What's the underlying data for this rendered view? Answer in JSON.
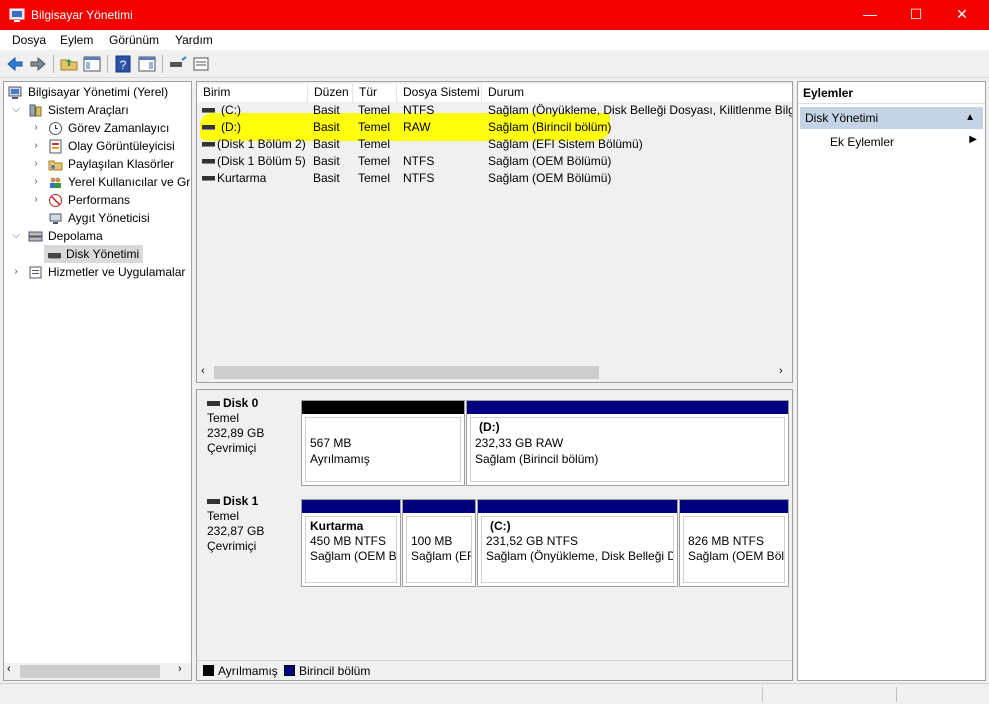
{
  "window": {
    "title": "Bilgisayar Yönetimi",
    "minimize": "—",
    "maximize": "☐",
    "close": "✕",
    "accent": "#f40000"
  },
  "menu": [
    "Dosya",
    "Eylem",
    "Görünüm",
    "Yardım"
  ],
  "tree": {
    "root": "Bilgisayar Yönetimi (Yerel)",
    "system_tools": "Sistem Araçları",
    "task_scheduler": "Görev Zamanlayıcı",
    "event_viewer": "Olay Görüntüleyicisi",
    "shared_folders": "Paylaşılan Klasörler",
    "local_users": "Yerel Kullanıcılar ve Gru",
    "performance": "Performans",
    "device_manager": "Aygıt Yöneticisi",
    "storage": "Depolama",
    "disk_management": "Disk Yönetimi",
    "services": "Hizmetler ve Uygulamalar"
  },
  "volumes": {
    "headers": [
      "Birim",
      "Düzen",
      "Tür",
      "Dosya Sistemi",
      "Durum"
    ],
    "rows": [
      [
        "(C:)",
        "Basit",
        "Temel",
        "NTFS",
        "Sağlam (Önyükleme, Disk Belleği Dosyası, Kilitlenme Bilgis"
      ],
      [
        "(D:)",
        "Basit",
        "Temel",
        "RAW",
        "Sağlam (Birincil bölüm)"
      ],
      [
        "(Disk 1 Bölüm 2)",
        "Basit",
        "Temel",
        "",
        "Sağlam (EFI Sistem Bölümü)"
      ],
      [
        "(Disk 1 Bölüm 5)",
        "Basit",
        "Temel",
        "NTFS",
        "Sağlam (OEM Bölümü)"
      ],
      [
        "Kurtarma",
        "Basit",
        "Temel",
        "NTFS",
        "Sağlam (OEM Bölümü)"
      ]
    ],
    "highlight_color": "#ffff00"
  },
  "disks": [
    {
      "name": "Disk 0",
      "type": "Temel",
      "size": "232,89 GB",
      "status": "Çevrimiçi",
      "partitions": [
        {
          "title": "",
          "line1": "567 MB",
          "line2": "Ayrılmamış",
          "color": "#000000"
        },
        {
          "title": "(D:)",
          "line1": "232,33 GB RAW",
          "line2": "Sağlam (Birincil bölüm)",
          "color": "#00007f"
        }
      ]
    },
    {
      "name": "Disk 1",
      "type": "Temel",
      "size": "232,87 GB",
      "status": "Çevrimiçi",
      "partitions": [
        {
          "title": "Kurtarma",
          "line1": "450 MB NTFS",
          "line2": "Sağlam (OEM Bı",
          "color": "#00007f"
        },
        {
          "title": "",
          "line1": "100 MB",
          "line2": "Sağlam (EF",
          "color": "#00007f"
        },
        {
          "title": "(C:)",
          "line1": "231,52 GB NTFS",
          "line2": "Sağlam (Önyükleme, Disk Belleği Dı",
          "color": "#00007f"
        },
        {
          "title": "",
          "line1": "826 MB NTFS",
          "line2": "Sağlam (OEM Bölü",
          "color": "#00007f"
        }
      ]
    }
  ],
  "legend": [
    {
      "label": "Ayrılmamış",
      "color": "#000000"
    },
    {
      "label": "Birincil bölüm",
      "color": "#00007f"
    }
  ],
  "actions": {
    "header": "Eylemler",
    "group": "Disk Yönetimi",
    "more": "Ek Eylemler"
  }
}
